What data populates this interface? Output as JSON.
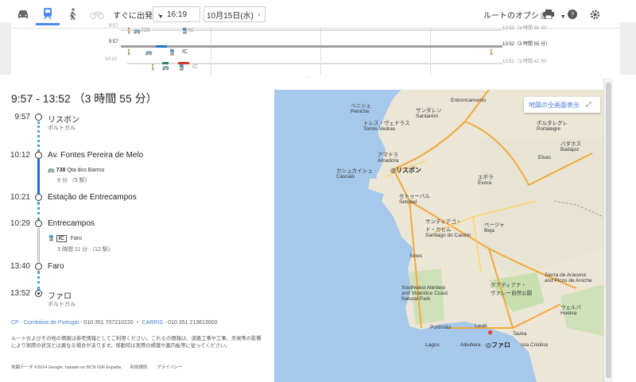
{
  "toolbar": {
    "depart_label": "すぐに出発",
    "time_value": "16:19",
    "date_value": "10月15日(水)",
    "route_options_label": "ルートのオプション"
  },
  "timeline": {
    "rows": [
      {
        "start": "9:57",
        "end": "13:52（3 時間 55 分）",
        "line1": "726",
        "line2": "IC"
      },
      {
        "start": "9:57",
        "end": "13:52（3 時間 55 分）",
        "line1": "",
        "line2": "IC"
      },
      {
        "start": "10:10",
        "end": "13:52（3 時間 42 分）",
        "line1": "",
        "line2": "IC"
      }
    ]
  },
  "route": {
    "summary": "9:57 - 13:52 （3 時間 55 分）",
    "steps": [
      {
        "time": "9:57",
        "name": "リスボン",
        "sub": "ポルトガル"
      },
      {
        "time": "10:12",
        "name": "Av. Fontes Pereira de Melo"
      },
      {
        "bus_num": "738",
        "bus_dest": "Qta dos Barros",
        "bus_dur": "9 分 （5 駅）"
      },
      {
        "time": "10:21",
        "name": "Estação de Entrecampos"
      },
      {
        "time": "10:29",
        "name": "Entrecampos"
      },
      {
        "train_badge": "IC",
        "train_dest": "Faro",
        "train_dur": "3 時間 11 分 （12 駅）"
      },
      {
        "time": "13:40",
        "name": "Faro"
      },
      {
        "time": "13:52",
        "name": "ファロ",
        "sub": "ポルトガル"
      }
    ],
    "agency1": "CP - Combóios de Portugal",
    "agency1_phone": " - 010 351 707210220 ・ ",
    "agency2": "CARRIS",
    "agency2_phone": " - 010 351 213613000",
    "disclaimer": "ルートおよびその他の情報は参考情報としてご利用ください。これらの情報は、道路工事や工事、天候等の影響により実際の状況とは異なる場合があります。移動時は実際の標識や案内板等に従ってください。"
  },
  "footer": {
    "map_data": "地図データ ©2014 Google, basado en BCN IGN España",
    "terms": "利用規約",
    "privacy": "プライバシー"
  },
  "map": {
    "fullscreen_label": "地図の全画面表示",
    "labels": {
      "lisbon": "リスボン",
      "faro": "ファロ",
      "peniche": "ペニシェ\nPeniche",
      "santarem": "サンタレン\nSantarém",
      "entroncamento": "Entroncamento",
      "torres": "トレス・ヴェドラス\nTorres Vedras",
      "amadora": "アマドラ\nAmadora",
      "cascais": "カシュカイシュ\nCascais",
      "setubal": "セトゥーバル\nSetúbal",
      "evora": "エボラ\nÉvora",
      "portalegre": "ポルタレグレ\nPortalegre",
      "badajoz": "バダホス\nBadajoz",
      "elvas": "Elvas",
      "beja": "ベージャ\nBeja",
      "sines": "Sines",
      "santiago": "サンティアゴ・\nド・カセム\nSantiago do Cacém",
      "alentejo": "Southwest Alentejo\nand Vicentine Coast\nNatural Park",
      "guadiana": "グアディアナ・\nヴァレー自然公園",
      "huelva": "ウェルバ\nHuelva",
      "portimao": "Portimão",
      "lagos": "Lagos",
      "albufeira": "Albufeira",
      "loule": "Loulé",
      "tavira": "Tavira",
      "aracena": "Sierra de Aracena\nand Picos de Aroche",
      "cristina": "Isla Cristina"
    }
  }
}
